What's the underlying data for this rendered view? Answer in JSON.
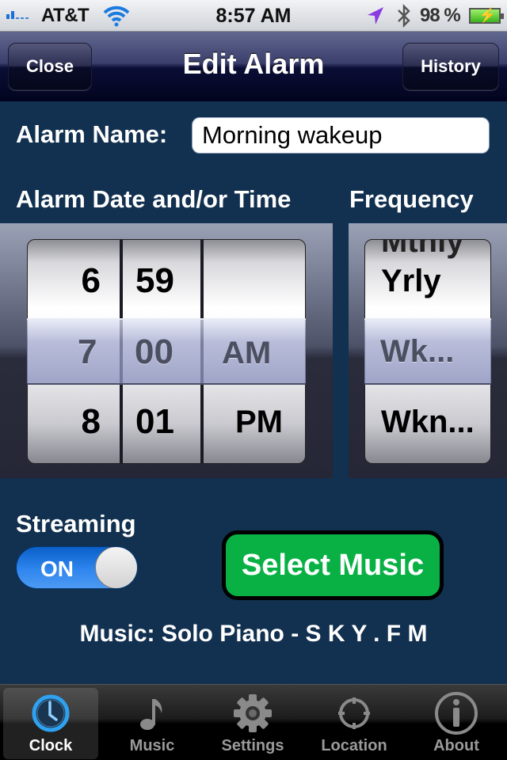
{
  "status_bar": {
    "carrier": "AT&T",
    "time": "8:57 AM",
    "battery_percent": "98 %",
    "icons": [
      "signal-bars-icon",
      "wifi-icon",
      "location-arrow-icon",
      "bluetooth-icon",
      "battery-charging-icon"
    ]
  },
  "nav": {
    "title": "Edit Alarm",
    "close_label": "Close",
    "history_label": "History"
  },
  "form": {
    "alarm_name_label": "Alarm Name:",
    "alarm_name_value": "Morning wakeup",
    "time_label": "Alarm Date and/or Time",
    "frequency_label": "Frequency"
  },
  "time_picker": {
    "hour": {
      "above": "6",
      "selected": "7",
      "below": "8"
    },
    "minute": {
      "above": "59",
      "selected": "00",
      "below": "01"
    },
    "ampm": {
      "above": "",
      "selected": "AM",
      "below": "PM"
    }
  },
  "frequency_picker": {
    "partial_above": "Mthly",
    "above": "Yrly",
    "selected": "Wk...",
    "below": "Wkn..."
  },
  "streaming": {
    "label": "Streaming",
    "toggle_state": "ON"
  },
  "select_music_label": "Select Music",
  "music_line": "Music: Solo Piano - S K Y . F M",
  "colors": {
    "content_bg": "#12304f",
    "select_music_green": "#09b145",
    "toggle_blue": "#2f86ee",
    "clock_tab_blue": "#2ea2f0"
  },
  "tabs": [
    {
      "label": "Clock",
      "icon": "clock-icon",
      "active": true
    },
    {
      "label": "Music",
      "icon": "music-note-icon",
      "active": false
    },
    {
      "label": "Settings",
      "icon": "gear-icon",
      "active": false
    },
    {
      "label": "Location",
      "icon": "crosshair-icon",
      "active": false
    },
    {
      "label": "About",
      "icon": "info-icon",
      "active": false
    }
  ]
}
